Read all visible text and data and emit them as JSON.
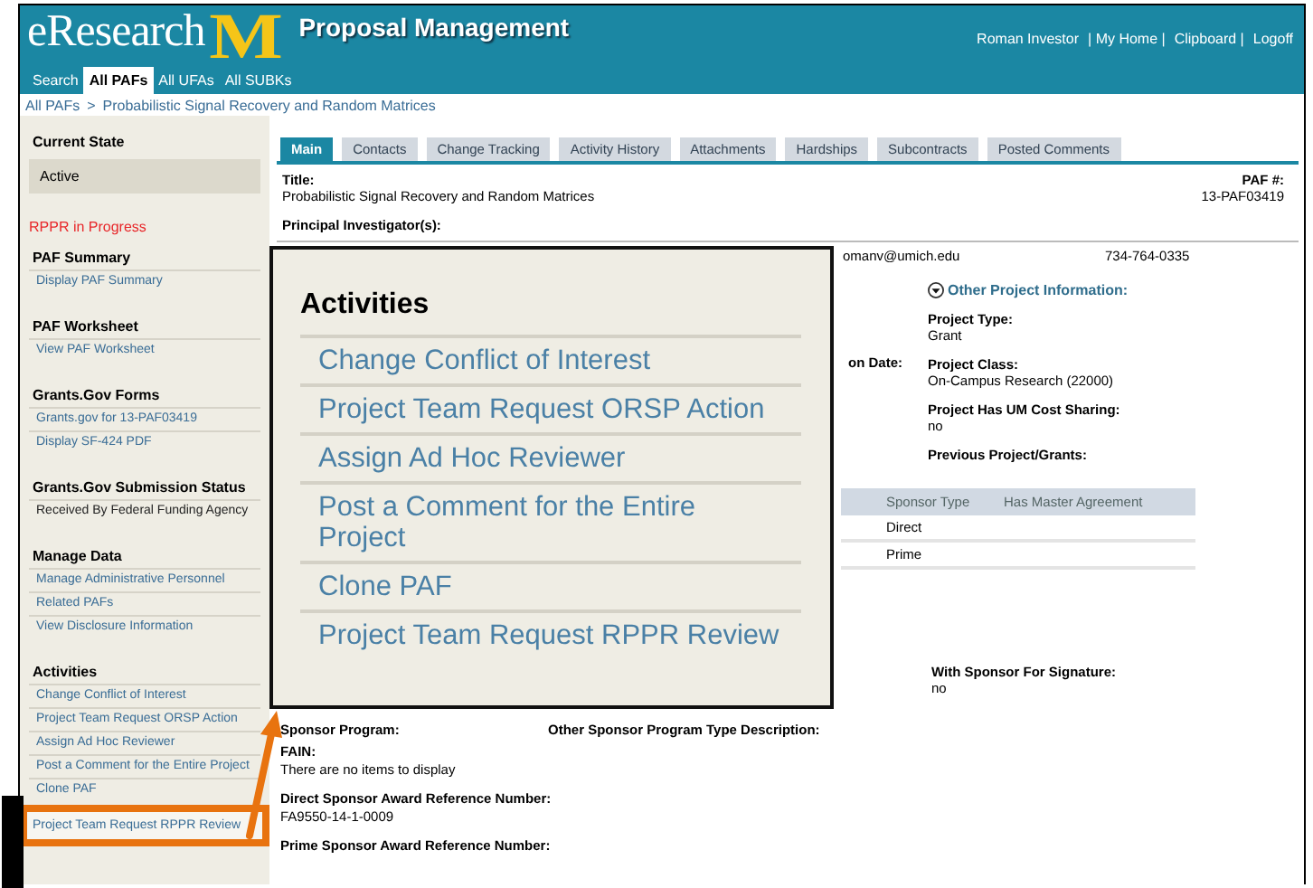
{
  "header": {
    "logo_text": "eResearch",
    "logo_mark": "M",
    "title": "Proposal Management",
    "user_links": [
      "Roman Investor",
      "| My Home |",
      "Clipboard |",
      "Logoff"
    ],
    "nav_tabs": [
      {
        "label": "Search",
        "selected": false
      },
      {
        "label": "All PAFs",
        "selected": true
      },
      {
        "label": "All UFAs",
        "selected": false
      },
      {
        "label": "All SUBKs",
        "selected": false
      }
    ]
  },
  "breadcrumb": [
    "All PAFs",
    ">",
    "Probabilistic Signal Recovery and Random Matrices"
  ],
  "sidebar": {
    "current_state": {
      "heading": "Current State",
      "value": "Active"
    },
    "status_note": "RPPR in Progress",
    "sections": [
      {
        "heading": "PAF Summary",
        "items": [
          {
            "label": "Display PAF Summary",
            "kind": "link",
            "highlighted": false
          }
        ]
      },
      {
        "heading": "PAF Worksheet",
        "items": [
          {
            "label": "View PAF Worksheet",
            "kind": "link",
            "highlighted": false
          }
        ]
      },
      {
        "heading": "Grants.Gov Forms",
        "items": [
          {
            "label": "Grants.gov for 13-PAF03419",
            "kind": "link",
            "highlighted": false
          },
          {
            "label": "Display SF-424 PDF",
            "kind": "link",
            "highlighted": false
          }
        ]
      },
      {
        "heading": "Grants.Gov Submission Status",
        "items": [
          {
            "label": "Received By Federal Funding Agency",
            "kind": "status",
            "highlighted": false
          }
        ]
      },
      {
        "heading": "Manage Data",
        "items": [
          {
            "label": "Manage Administrative Personnel",
            "kind": "link",
            "highlighted": false
          },
          {
            "label": "Related PAFs",
            "kind": "link",
            "highlighted": false
          },
          {
            "label": "View Disclosure Information",
            "kind": "link",
            "highlighted": false
          }
        ]
      },
      {
        "heading": "Activities",
        "items": [
          {
            "label": "Change Conflict of Interest",
            "kind": "link",
            "highlighted": false
          },
          {
            "label": "Project Team Request ORSP Action",
            "kind": "link",
            "highlighted": false
          },
          {
            "label": "Assign Ad Hoc Reviewer",
            "kind": "link",
            "highlighted": false
          },
          {
            "label": "Post a Comment for the Entire Project",
            "kind": "link",
            "highlighted": false
          },
          {
            "label": "Clone PAF",
            "kind": "link",
            "highlighted": false
          },
          {
            "label": "Project Team Request RPPR Review",
            "kind": "link",
            "highlighted": true
          }
        ]
      }
    ]
  },
  "content_tabs": [
    {
      "label": "Main",
      "selected": true
    },
    {
      "label": "Contacts",
      "selected": false
    },
    {
      "label": "Change Tracking",
      "selected": false
    },
    {
      "label": "Activity History",
      "selected": false
    },
    {
      "label": "Attachments",
      "selected": false
    },
    {
      "label": "Hardships",
      "selected": false
    },
    {
      "label": "Subcontracts",
      "selected": false
    },
    {
      "label": "Posted Comments",
      "selected": false
    }
  ],
  "main": {
    "title_label": "Title:",
    "title_value": "Probabilistic Signal Recovery and Random Matrices",
    "paf_label": "PAF #:",
    "paf_value": "13-PAF03419",
    "pi_label": "Principal Investigator(s):",
    "pi_email": "omanv@umich.edu",
    "pi_phone": "734-764-0335",
    "date_label": "on Date:",
    "other_info_heading": "Other Project Information:",
    "other_info": [
      {
        "label": "Project Type:",
        "value": "Grant"
      },
      {
        "label": "Project Class:",
        "value": "On-Campus Research (22000)"
      },
      {
        "label": "Project Has UM Cost Sharing:",
        "value": "no"
      },
      {
        "label": "Previous Project/Grants:"
      }
    ],
    "sponsor_table": {
      "columns": [
        "Sponsor Type",
        "Has Master Agreement"
      ],
      "rows": [
        [
          "Direct",
          ""
        ],
        [
          "Prime",
          ""
        ]
      ]
    },
    "signature": {
      "label": "With Sponsor For Signature:",
      "value": "no"
    },
    "sponsor_program_label": "Sponsor Program:",
    "other_program_label": "Other Sponsor Program Type Description:",
    "fain_label": "FAIN:",
    "fain_value": "There are no items to display",
    "direct_ref_label": "Direct Sponsor Award Reference Number:",
    "direct_ref_value": "FA9550-14-1-0009",
    "prime_ref_label": "Prime Sponsor Award Reference Number:"
  },
  "callout": {
    "heading": "Activities",
    "items": [
      "Change Conflict of Interest",
      "Project Team Request ORSP Action",
      "Assign Ad Hoc Reviewer",
      "Post a Comment for the Entire Project",
      "Clone PAF",
      "Project Team Request RPPR Review"
    ]
  }
}
